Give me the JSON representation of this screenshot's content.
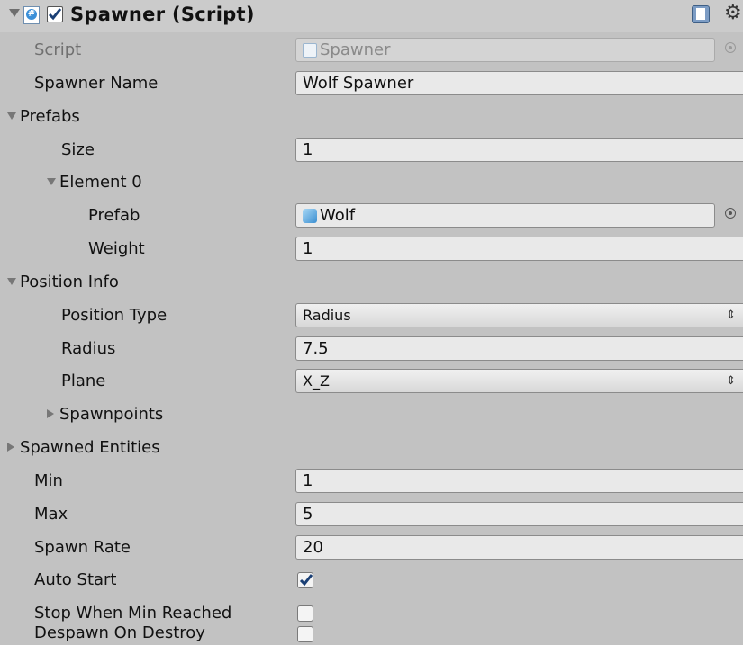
{
  "header": {
    "title": "Spawner (Script)",
    "enabled": true
  },
  "rows": {
    "script": {
      "label": "Script",
      "value": "Spawner"
    },
    "spawner_name": {
      "label": "Spawner Name",
      "value": "Wolf Spawner"
    },
    "prefabs": {
      "label": "Prefabs"
    },
    "size": {
      "label": "Size",
      "value": "1"
    },
    "element0": {
      "label": "Element 0"
    },
    "prefab": {
      "label": "Prefab",
      "value": "Wolf"
    },
    "weight": {
      "label": "Weight",
      "value": "1"
    },
    "position_info": {
      "label": "Position Info"
    },
    "position_type": {
      "label": "Position Type",
      "value": "Radius"
    },
    "radius": {
      "label": "Radius",
      "value": "7.5"
    },
    "plane": {
      "label": "Plane",
      "value": "X_Z"
    },
    "spawnpoints": {
      "label": "Spawnpoints"
    },
    "spawned_entities": {
      "label": "Spawned Entities"
    },
    "min": {
      "label": "Min",
      "value": "1"
    },
    "max": {
      "label": "Max",
      "value": "5"
    },
    "spawn_rate": {
      "label": "Spawn Rate",
      "value": "20"
    },
    "auto_start": {
      "label": "Auto Start",
      "checked": true
    },
    "stop_when_min": {
      "label": "Stop When Min Reached",
      "checked": false
    },
    "despawn_on_destroy": {
      "label": "Despawn On Destroy",
      "checked": false
    }
  },
  "icons": {
    "fold": "triangle-icon",
    "script": "csharp-script-icon",
    "help": "help-book-icon",
    "settings": "gear-icon",
    "prefab": "cube-icon",
    "object_picker": "target-circle-icon",
    "popup": "up-down-arrow-icon"
  },
  "colors": {
    "background": "#c2c2c2",
    "field": "#e9e9e9",
    "checkmark": "#1a3f75"
  }
}
